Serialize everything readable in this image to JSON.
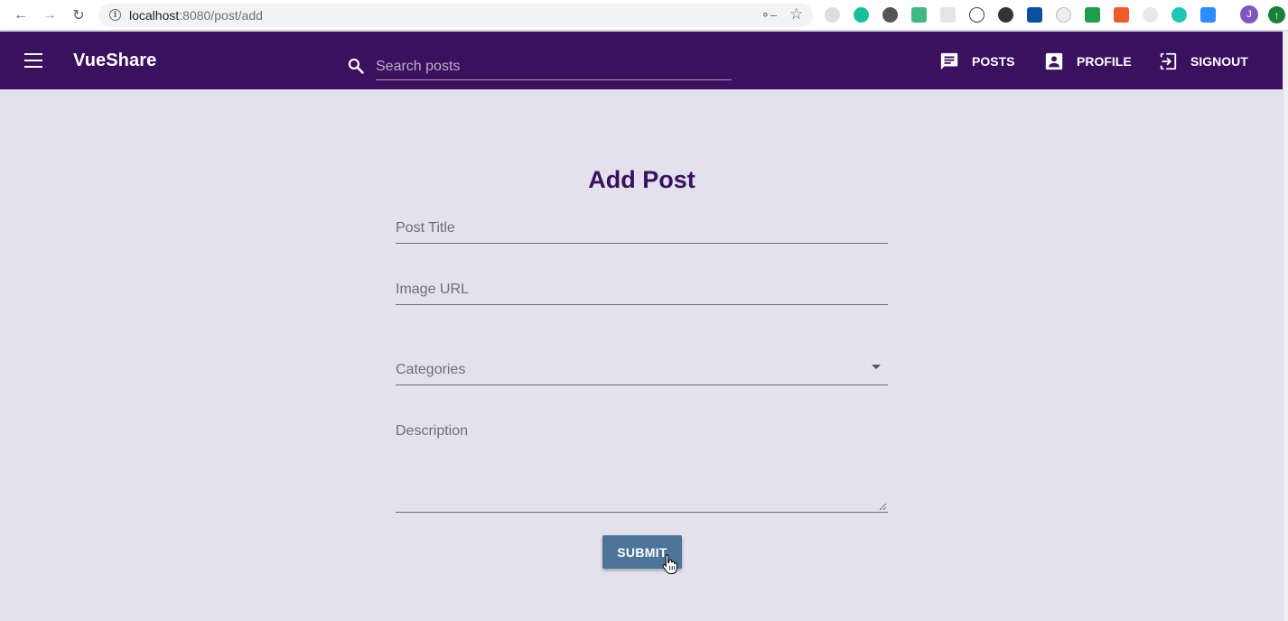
{
  "browser": {
    "url_host": "localhost",
    "url_rest": ":8080/post/add",
    "avatar_letter": "J"
  },
  "appbar": {
    "brand": "VueShare",
    "search_placeholder": "Search posts",
    "nav": [
      {
        "label": "POSTS",
        "icon": "message-icon"
      },
      {
        "label": "PROFILE",
        "icon": "account-box-icon"
      },
      {
        "label": "SIGNOUT",
        "icon": "exit-icon"
      }
    ],
    "color": "#3a115f"
  },
  "form": {
    "title": "Add Post",
    "post_title_label": "Post Title",
    "image_url_label": "Image URL",
    "categories_label": "Categories",
    "description_label": "Description",
    "submit_label": "SUBMIT"
  },
  "colors": {
    "background": "#e2e1ec",
    "title": "#3a115f",
    "submit": "#4d7499"
  }
}
